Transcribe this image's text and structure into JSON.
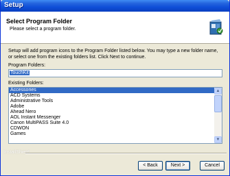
{
  "window": {
    "title": "Setup"
  },
  "header": {
    "title": "Select Program Folder",
    "subtitle": "Please select a program folder.",
    "icon": "setup-box-icon"
  },
  "description": "Setup will add program icons to the Program Folder listed below.  You may type a new folder name, or select one from the existing folders list.  Click Next to continue.",
  "program_folder": {
    "label": "Program Folders:",
    "value": "TouchKit"
  },
  "existing_folders": {
    "label": "Existing Folders:",
    "items": [
      "Accessories",
      "ACD Systems",
      "Administrative Tools",
      "Adobe",
      "Ahead Nero",
      "AOL Instant Messenger",
      "Canon MultiPASS Suite 4.0",
      "CDWON",
      "Games"
    ],
    "selected": "Accessories"
  },
  "branding": "InstallShield",
  "buttons": {
    "back": "< Back",
    "next": "Next >",
    "cancel": "Cancel"
  },
  "colors": {
    "titlebar": "#0A3FC0",
    "selection": "#316AC5",
    "dialog_bg": "#ECE9D8"
  }
}
